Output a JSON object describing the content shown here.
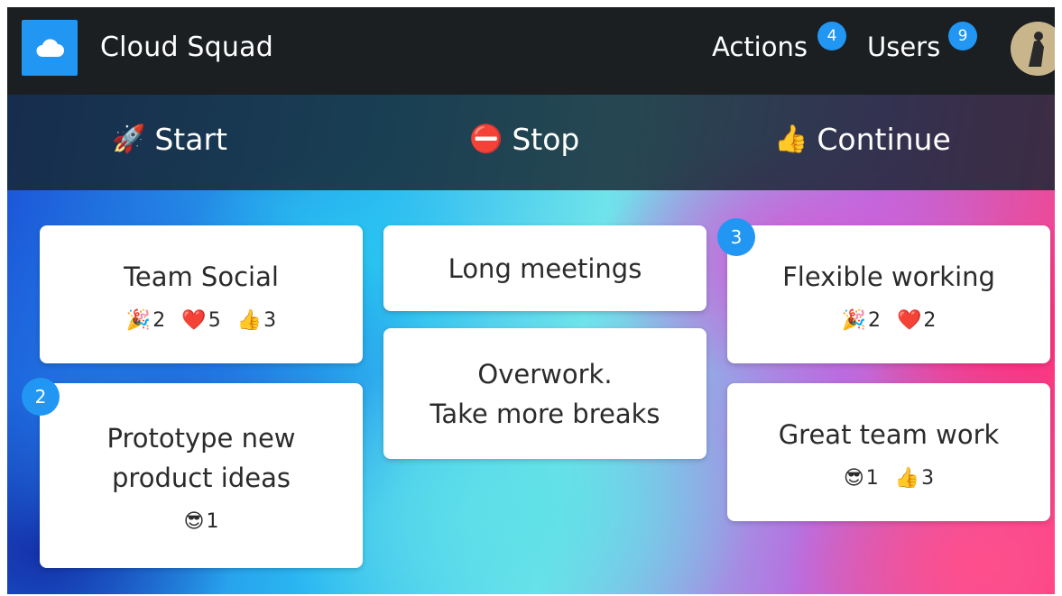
{
  "app": {
    "title": "Cloud Squad",
    "logo_icon": "cloud-icon",
    "accent": "#2196f3"
  },
  "nav": {
    "actions": {
      "label": "Actions",
      "count": "4"
    },
    "users": {
      "label": "Users",
      "count": "9"
    }
  },
  "columns": [
    {
      "icon": "rocket-icon",
      "emoji": "🚀",
      "label": "Start"
    },
    {
      "icon": "no-entry-icon",
      "emoji": "⛔",
      "label": "Stop"
    },
    {
      "icon": "thumbs-up-icon",
      "emoji": "👍",
      "label": "Continue"
    }
  ],
  "cards": {
    "team_social": {
      "text": "Team Social",
      "reactions": [
        {
          "icon": "party-popper-icon",
          "emoji": "🎉",
          "count": "2"
        },
        {
          "icon": "heart-icon",
          "emoji": "❤️",
          "count": "5"
        },
        {
          "icon": "thumbs-up-icon",
          "emoji": "👍",
          "count": "3"
        }
      ]
    },
    "prototype": {
      "text_line1": "Prototype new",
      "text_line2": "product ideas",
      "votes": "2",
      "reactions": [
        {
          "icon": "sunglasses-face-icon",
          "emoji": "😎",
          "count": "1"
        }
      ]
    },
    "long_meetings": {
      "text": "Long meetings"
    },
    "overwork": {
      "text_line1": "Overwork.",
      "text_line2": "Take more breaks"
    },
    "flexible": {
      "text": "Flexible working",
      "votes": "3",
      "reactions": [
        {
          "icon": "party-popper-icon",
          "emoji": "🎉",
          "count": "2"
        },
        {
          "icon": "heart-icon",
          "emoji": "❤️",
          "count": "2"
        }
      ]
    },
    "great_team": {
      "text": "Great team work",
      "reactions": [
        {
          "icon": "sunglasses-face-icon",
          "emoji": "😎",
          "count": "1"
        },
        {
          "icon": "thumbs-up-icon",
          "emoji": "👍",
          "count": "3"
        }
      ]
    }
  }
}
